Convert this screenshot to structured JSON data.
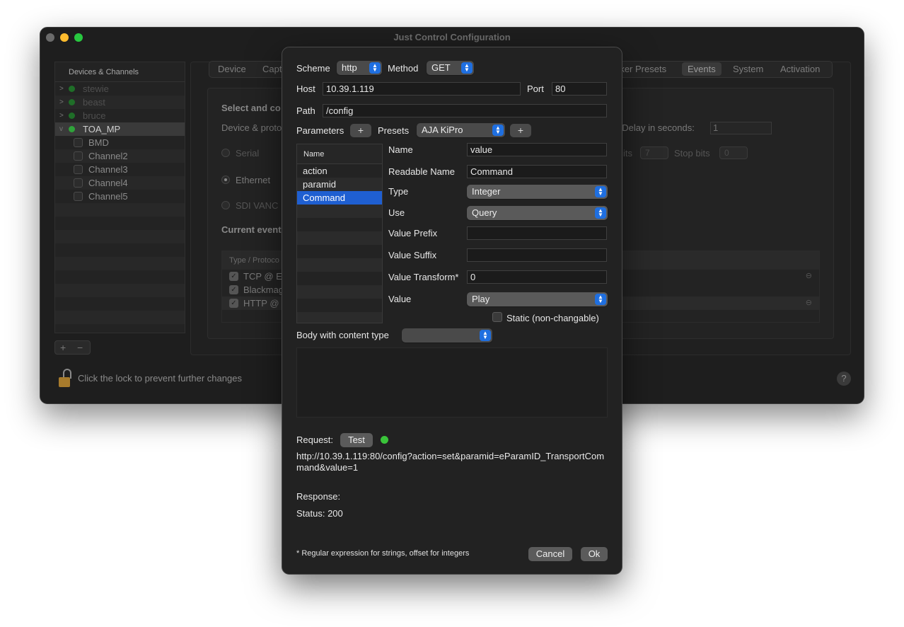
{
  "window": {
    "title": "Just Control Configuration"
  },
  "sidebar": {
    "header": "Devices & Channels",
    "devices": [
      "stewie",
      "beast",
      "bruce",
      "TOA_MP"
    ],
    "channels": [
      "BMD",
      "Channel2",
      "Channel3",
      "Channel4",
      "Channel5"
    ],
    "add": "+",
    "remove": "−"
  },
  "tabs": [
    "Device",
    "Capt",
    "rker Presets",
    "Events",
    "System",
    "Activation"
  ],
  "bg": {
    "select_text": "Select and co",
    "device_proto": "Device & proto",
    "delay_label": "t/Delay in seconds:",
    "delay_value": "1",
    "serial": "Serial",
    "ethernet": "Ethernet",
    "sdi": "SDI VANC",
    "bits_label": "its",
    "bits_value": "7",
    "stop_bits_label": "Stop bits",
    "stop_bits_value": "0",
    "current_events": "Current event",
    "table_header": "Type / Protoco",
    "rows": [
      "TCP @ Et",
      "Blackmag",
      "HTTP @ I"
    ],
    "lock_text": "Click the lock to prevent further changes",
    "help": "?"
  },
  "dialog": {
    "scheme_label": "Scheme",
    "scheme_value": "http",
    "method_label": "Method",
    "method_value": "GET",
    "host_label": "Host",
    "host_value": "10.39.1.119",
    "port_label": "Port",
    "port_value": "80",
    "path_label": "Path",
    "path_value": "/config",
    "parameters_label": "Parameters",
    "add": "+",
    "presets_label": "Presets",
    "presets_value": "AJA KiPro",
    "param_header": "Name",
    "params": [
      "action",
      "paramid",
      "Command"
    ],
    "name_label": "Name",
    "name_value": "value",
    "readable_label": "Readable Name",
    "readable_value": "Command",
    "type_label": "Type",
    "type_value": "Integer",
    "use_label": "Use",
    "use_value": "Query",
    "prefix_label": "Value Prefix",
    "prefix_value": "",
    "suffix_label": "Value Suffix",
    "suffix_value": "",
    "transform_label": "Value Transform*",
    "transform_value": "0",
    "value_label": "Value",
    "value_value": "Play",
    "static_label": "Static (non-changable)",
    "body_label": "Body with content type",
    "body_value": "",
    "request_label": "Request:",
    "test_button": "Test",
    "request_url": "http://10.39.1.119:80/config?action=set&paramid=eParamID_TransportCommand&value=1",
    "response_label": "Response:",
    "status_text": "Status: 200",
    "footnote": "* Regular expression for strings, offset for integers",
    "cancel": "Cancel",
    "ok": "Ok"
  },
  "colors": {
    "accent": "#1f6fe0",
    "selection": "#1f5fd1",
    "status_ok": "#3ac43a"
  }
}
